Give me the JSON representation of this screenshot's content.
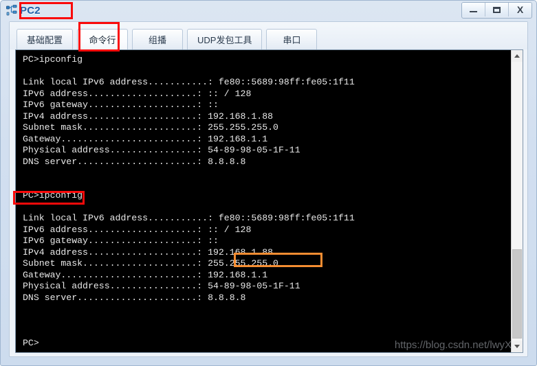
{
  "window": {
    "title": "PC2",
    "icon": "pc-network-icon",
    "controls": [
      {
        "name": "minimize",
        "glyph": "—"
      },
      {
        "name": "maximize",
        "glyph": "□"
      },
      {
        "name": "close",
        "glyph": "X"
      }
    ]
  },
  "tabs": [
    {
      "label": "基础配置",
      "name": "tab-basic-config",
      "active": false
    },
    {
      "label": "命令行",
      "name": "tab-command-line",
      "active": true
    },
    {
      "label": "组播",
      "name": "tab-multicast",
      "active": false
    },
    {
      "label": "UDP发包工具",
      "name": "tab-udp-tool",
      "active": false
    },
    {
      "label": "串口",
      "name": "tab-serial-port",
      "active": false
    }
  ],
  "console": {
    "text": "PC>ipconfig\n\nLink local IPv6 address...........: fe80::5689:98ff:fe05:1f11\nIPv6 address....................: :: / 128\nIPv6 gateway....................: ::\nIPv4 address....................: 192.168.1.88\nSubnet mask.....................: 255.255.255.0\nGateway.........................: 192.168.1.1\nPhysical address................: 54-89-98-05-1F-11\nDNS server......................: 8.8.8.8\n\n\nPC>ipconfig\n\nLink local IPv6 address...........: fe80::5689:98ff:fe05:1f11\nIPv6 address....................: :: / 128\nIPv6 gateway....................: ::\nIPv4 address....................: 192.168.1.88\nSubnet mask.....................: 255.255.255.0\nGateway.........................: 192.168.1.1\nPhysical address................: 54-89-98-05-1F-11\nDNS server......................: 8.8.8.8\n\n\n\nPC>",
    "prompt": "PC>",
    "command": "ipconfig",
    "blocks": [
      {
        "command": "PC>ipconfig",
        "rows": [
          {
            "label": "Link local IPv6 address",
            "value": "fe80::5689:98ff:fe05:1f11"
          },
          {
            "label": "IPv6 address",
            "value": ":: / 128"
          },
          {
            "label": "IPv6 gateway",
            "value": "::"
          },
          {
            "label": "IPv4 address",
            "value": "192.168.1.88"
          },
          {
            "label": "Subnet mask",
            "value": "255.255.255.0"
          },
          {
            "label": "Gateway",
            "value": "192.168.1.1"
          },
          {
            "label": "Physical address",
            "value": "54-89-98-05-1F-11"
          },
          {
            "label": "DNS server",
            "value": "8.8.8.8"
          }
        ]
      },
      {
        "command": "PC>ipconfig",
        "rows": [
          {
            "label": "Link local IPv6 address",
            "value": "fe80::5689:98ff:fe05:1f11"
          },
          {
            "label": "IPv6 address",
            "value": ":: / 128"
          },
          {
            "label": "IPv6 gateway",
            "value": "::"
          },
          {
            "label": "IPv4 address",
            "value": "192.168.1.88"
          },
          {
            "label": "Subnet mask",
            "value": "255.255.255.0"
          },
          {
            "label": "Gateway",
            "value": "192.168.1.1"
          },
          {
            "label": "Physical address",
            "value": "54-89-98-05-1F-11"
          },
          {
            "label": "DNS server",
            "value": "8.8.8.8"
          }
        ]
      }
    ]
  },
  "watermark": "https://blog.csdn.net/lwyX",
  "scrollbar": {
    "up_arrow": "scroll-up-arrow",
    "down_arrow": "scroll-down-arrow"
  },
  "annotations": [
    {
      "name": "annotation-title",
      "color": "#fa0a0a",
      "target": "PC2"
    },
    {
      "name": "annotation-command-line-tab",
      "color": "#fa0a0a",
      "target": "命令行"
    },
    {
      "name": "annotation-second-ipconfig",
      "color": "#fa0a0a",
      "target": "PC>ipconfig"
    },
    {
      "name": "annotation-ipv4-address",
      "color": "#f58d32",
      "target": "192.168.1.88"
    }
  ],
  "colors": {
    "title_blue": "#1f5fa8",
    "annotation_red": "#fa0a0a",
    "annotation_orange": "#f58d32",
    "console_bg": "#000000",
    "console_fg": "#e8e8e8"
  }
}
